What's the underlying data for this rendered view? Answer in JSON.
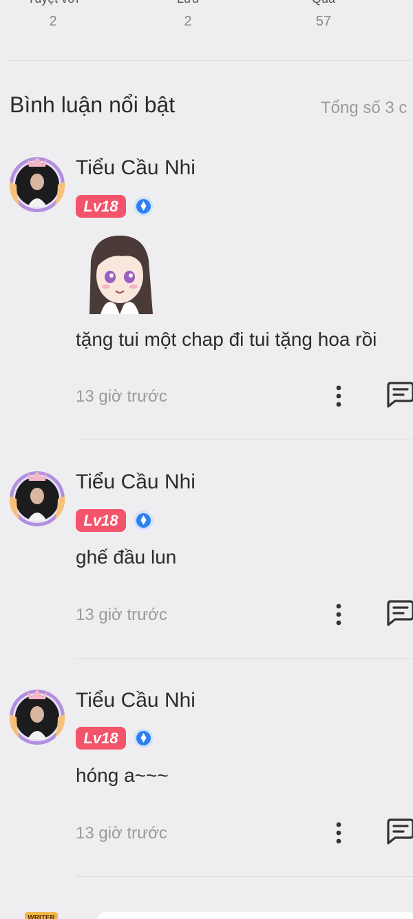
{
  "stats": [
    {
      "label": "Tuyệt vời",
      "value": "2"
    },
    {
      "label": "Lưu",
      "value": "2"
    },
    {
      "label": "Quà",
      "value": "57"
    }
  ],
  "section": {
    "title": "Bình luận nổi bật",
    "total": "Tổng số 3 c"
  },
  "comments": [
    {
      "author": "Tiểu Cầu Nhi",
      "level": "Lv18",
      "text": "tặng tui một chap đi tui tặng hoa rồi",
      "time": "13 giờ trước",
      "has_sticker": true
    },
    {
      "author": "Tiểu Cầu Nhi",
      "level": "Lv18",
      "text": "ghế đầu lun",
      "time": "13 giờ trước",
      "has_sticker": false
    },
    {
      "author": "Tiểu Cầu Nhi",
      "level": "Lv18",
      "text": "hóng a~~~",
      "time": "13 giờ trước",
      "has_sticker": false
    }
  ],
  "footer": {
    "badge_text": "WRITER"
  },
  "colors": {
    "background": "#eeeef0",
    "level_badge": "#f3546a",
    "vip_badge": "#2f80ed",
    "muted_text": "#9a9a9a"
  },
  "icons": [
    "avatar-frame",
    "vip-badge-icon",
    "more-options-icon",
    "reply-comment-icon",
    "anime-sticker"
  ]
}
